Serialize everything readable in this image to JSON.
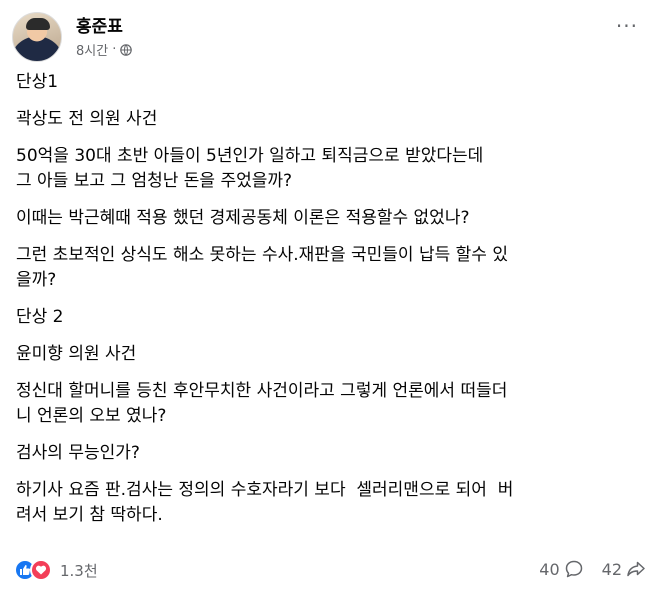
{
  "post": {
    "author": "홍준표",
    "time": "8시간",
    "paragraphs": [
      "단상1",
      "곽상도 전 의원 사건",
      "50억을 30대 초반 아들이 5년인가 일하고 퇴직금으로 받았다는데\n그 아들 보고 그 엄청난 돈을 주었을까?",
      "이때는 박근혜때 적용 했던 경제공동체 이론은 적용할수 없었나?",
      "그런 초보적인 상식도 해소 못하는 수사.재판을 국민들이 납득 할수 있\n을까?",
      "단상 2",
      "윤미향 의원 사건",
      "정신대 할머니를 등친 후안무치한 사건이라고 그렇게 언론에서 떠들더\n니 언론의 오보 였나?",
      "검사의 무능인가?",
      "하기사 요즘 판.검사는 정의의 수호자라기 보다  셀러리맨으로 되어  버\n려서 보기 참 딱하다."
    ]
  },
  "footer": {
    "reactions_count": "1.3천",
    "comments_count": "40",
    "shares_count": "42"
  },
  "icons": {
    "privacy": "globe-icon",
    "menu": "more-options-icon",
    "like": "like-icon",
    "love": "love-icon",
    "comment": "comment-icon",
    "share": "share-icon"
  },
  "colors": {
    "like": "#1877f2",
    "love": "#f33e58",
    "secondary_text": "#65676b"
  }
}
